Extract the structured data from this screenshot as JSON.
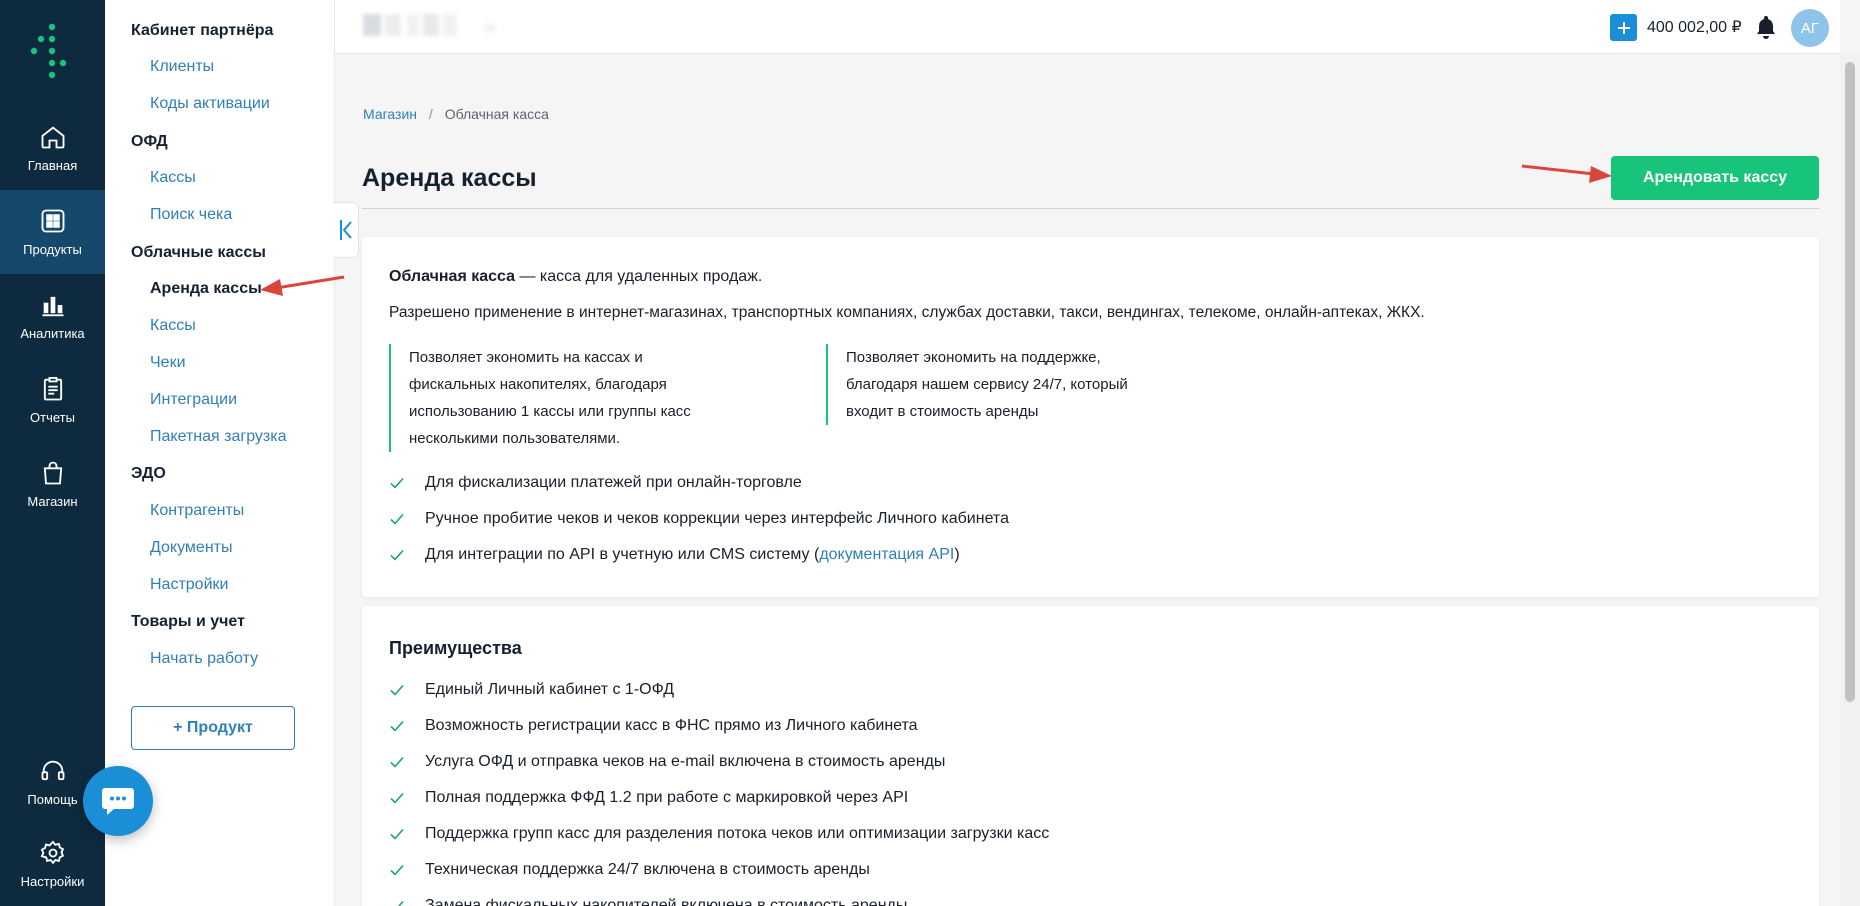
{
  "rail": {
    "items": [
      {
        "label": "Главная",
        "icon": "home-icon"
      },
      {
        "label": "Продукты",
        "icon": "grid-icon"
      },
      {
        "label": "Аналитика",
        "icon": "chart-icon"
      },
      {
        "label": "Отчеты",
        "icon": "clipboard-icon"
      },
      {
        "label": "Магазин",
        "icon": "bag-icon"
      },
      {
        "label": "Помощь",
        "icon": "headset-icon"
      },
      {
        "label": "Настройки",
        "icon": "gear-icon"
      }
    ],
    "active": "Продукты"
  },
  "menu": {
    "groups": [
      {
        "title": "Кабинет партнёра",
        "links": [
          "Клиенты",
          "Коды активации"
        ]
      },
      {
        "title": "ОФД",
        "links": [
          "Кассы",
          "Поиск чека"
        ]
      },
      {
        "title": "Облачные кассы",
        "links": [
          "Аренда кассы",
          "Кассы",
          "Чеки",
          "Интеграции",
          "Пакетная загрузка"
        ]
      },
      {
        "title": "ЭДО",
        "links": [
          "Контрагенты",
          "Документы",
          "Настройки"
        ]
      },
      {
        "title": "Товары и учет",
        "links": [
          "Начать работу"
        ]
      }
    ],
    "active_link": "Аренда кассы",
    "add_product_label": "+ Продукт"
  },
  "header": {
    "balance": "400 002,00 ₽",
    "avatar_initials": "АГ"
  },
  "breadcrumb": {
    "items": [
      "Магазин",
      "Облачная касса"
    ],
    "separator": "/"
  },
  "page": {
    "title": "Аренда кассы",
    "rent_button_label": "Арендовать кассу"
  },
  "intro_card": {
    "lead_bold": "Облачная касса",
    "lead_rest": " — касса для удаленных продаж.",
    "allowed": "Разрешено применение в интернет-магазинах, транспортных компаниях, службах доставки, такси, вендингах, телекоме, онлайн-аптеках, ЖКХ.",
    "feature_1": [
      "Позволяет экономить на кассах и",
      "фискальных накопителях, благодаря",
      "использованию 1 кассы или группы касс",
      "несколькими пользователями."
    ],
    "feature_2": [
      "Позволяет экономить на поддержке,",
      "благодаря нашем сервису 24/7, который",
      "входит в стоимость аренды"
    ],
    "checks": [
      "Для фискализации платежей при онлайн-торговле",
      "Ручное пробитие чеков и чеков коррекции через интерфейс Личного кабинета"
    ],
    "api_check_prefix": "Для интеграции по API в учетную или CMS систему (",
    "api_link": "документация API",
    "api_check_suffix": ")"
  },
  "benefits_card": {
    "title": "Преимущества",
    "items": [
      "Единый Личный кабинет с 1-ОФД",
      "Возможность регистрации касс в ФНС прямо из Личного кабинета",
      "Услуга ОФД и отправка чеков на e-mail включена в стоимость аренды",
      "Полная поддержка ФФД 1.2 при работе с маркировкой через API",
      "Поддержка групп касс для разделения потока чеков или оптимизации загрузки касс",
      "Техническая поддержка 24/7 включена в стоимость аренды",
      "Замена фискальных накопителей включена в стоимость аренды"
    ]
  },
  "colors": {
    "rail_bg": "#0d2a3f",
    "rail_active": "#16486b",
    "accent_green": "#18c47a",
    "link_blue": "#2f7fb8",
    "annotation_red": "#d9463b"
  }
}
